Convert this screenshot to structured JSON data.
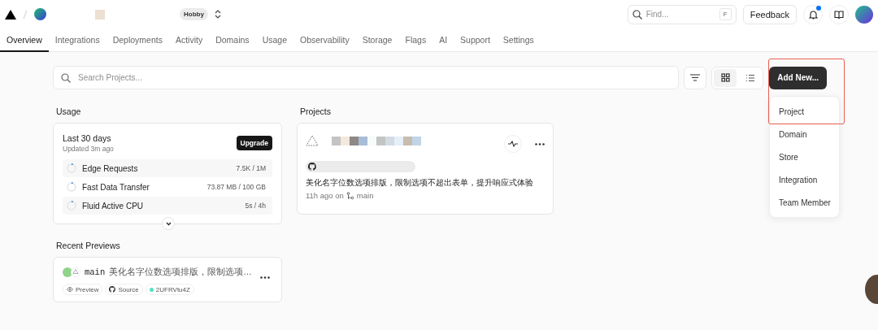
{
  "header": {
    "plan_badge": "Hobby",
    "find": {
      "placeholder": "Find...",
      "shortcut": "F"
    },
    "feedback": "Feedback",
    "notifications": {
      "unread": true
    }
  },
  "tabs": [
    {
      "label": "Overview",
      "selected": true
    },
    {
      "label": "Integrations",
      "selected": false
    },
    {
      "label": "Deployments",
      "selected": false
    },
    {
      "label": "Activity",
      "selected": false
    },
    {
      "label": "Domains",
      "selected": false
    },
    {
      "label": "Usage",
      "selected": false
    },
    {
      "label": "Observability",
      "selected": false
    },
    {
      "label": "Storage",
      "selected": false
    },
    {
      "label": "Flags",
      "selected": false
    },
    {
      "label": "AI",
      "selected": false
    },
    {
      "label": "Support",
      "selected": false
    },
    {
      "label": "Settings",
      "selected": false
    }
  ],
  "toolbar": {
    "search": {
      "placeholder": "Search Projects..."
    },
    "views": [
      {
        "kind": "grid",
        "selected": true
      },
      {
        "kind": "list",
        "selected": false
      }
    ],
    "add_button": "Add New..."
  },
  "add_menu": {
    "items": [
      "Project",
      "Domain",
      "Store",
      "Integration",
      "Team Member"
    ]
  },
  "usage": {
    "title": "Usage",
    "period": "Last 30 days",
    "updated": "Updated 3m ago",
    "upgrade": "Upgrade",
    "metrics": [
      {
        "name": "Edge Requests",
        "reading": "7.5K / 1M",
        "level": 0.05
      },
      {
        "name": "Fast Data Transfer",
        "reading": "73.87 MB / 100 GB",
        "level": 0.05
      },
      {
        "name": "Fluid Active CPU",
        "reading": "5s / 4h",
        "level": 0.05
      }
    ]
  },
  "projects": {
    "title": "Projects",
    "cards": [
      {
        "commit": "美化名字位数选项排版，限制选项不超出表单，提升响应式体验",
        "time": "11h ago on",
        "branch": "main"
      }
    ]
  },
  "recent_previews": {
    "title": "Recent Previews",
    "items": [
      {
        "branch": "main",
        "message": "美化名字位数选项排版，限制选项…",
        "links": [
          "Preview",
          "Source"
        ],
        "deployment": "2UFRVtu4Z",
        "color": "#50e3c2"
      }
    ]
  }
}
